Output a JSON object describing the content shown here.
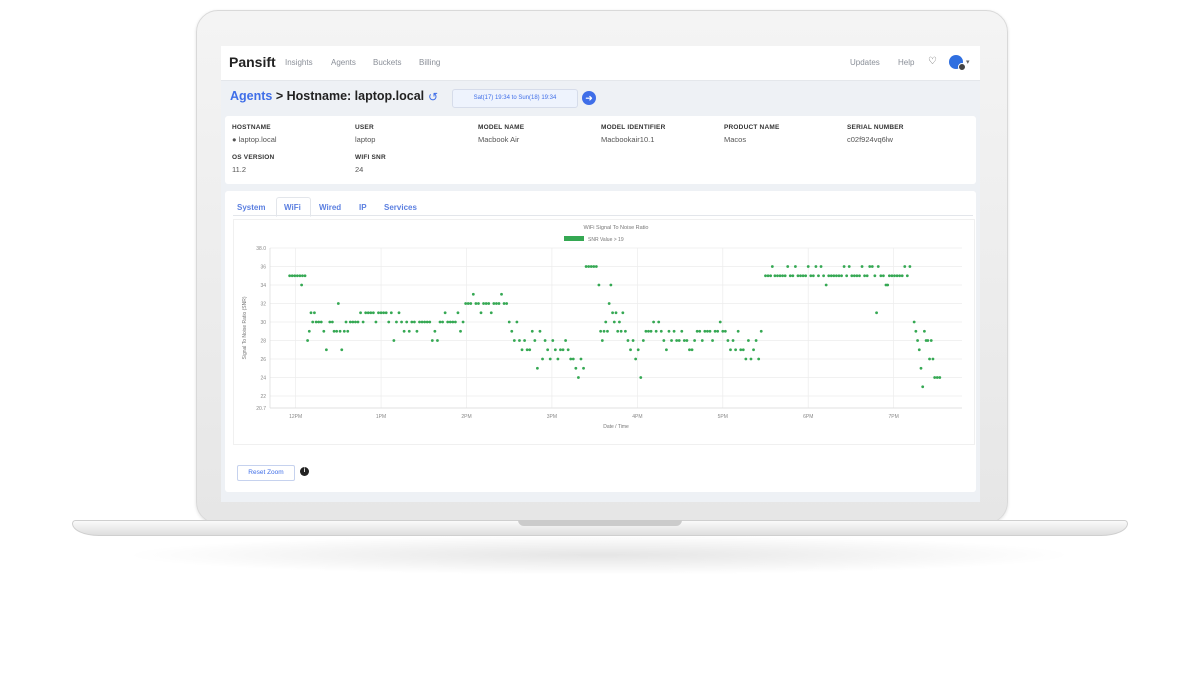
{
  "nav": {
    "brand": "Pansift",
    "links": [
      "Insights",
      "Agents",
      "Buckets",
      "Billing"
    ],
    "right_links": [
      "Updates",
      "Help"
    ],
    "icons": [
      "bell-icon",
      "avatar"
    ]
  },
  "header": {
    "breadcrumb_agents": "Agents",
    "breadcrumb_rest": " > Hostname: laptop.local",
    "date_range": "Sat(17) 19:34 to Sun(18) 19:34",
    "icons": [
      "history-icon",
      "arrow-right-circle-icon"
    ]
  },
  "agent_info": {
    "fields": [
      {
        "label": "HOSTNAME",
        "value": "laptop.local"
      },
      {
        "label": "USER",
        "value": "laptop"
      },
      {
        "label": "MODEL NAME",
        "value": "Macbook Air"
      },
      {
        "label": "MODEL IDENTIFIER",
        "value": "Macbookair10.1"
      },
      {
        "label": "PRODUCT NAME",
        "value": "Macos"
      },
      {
        "label": "SERIAL NUMBER",
        "value": "c02f924vq6lw"
      },
      {
        "label": "OS VERSION",
        "value": "11.2"
      },
      {
        "label": "WIFI SNR",
        "value": "24"
      }
    ]
  },
  "tabs": [
    "System",
    "WiFi",
    "Wired",
    "IP",
    "Services"
  ],
  "active_tab": "WiFi",
  "reset_zoom": "Reset Zoom",
  "colors": {
    "accent": "#3f6ee8",
    "series": "#35a853"
  },
  "chart_data": {
    "type": "scatter",
    "title": "WiFi Signal To Noise Ratio",
    "xlabel": "Date / Time",
    "ylabel": "Signal To Noise Ratio (SNR)",
    "ylim": [
      20.7,
      38.0
    ],
    "yticks": [
      "38.0",
      "36",
      "34",
      "32",
      "30",
      "28",
      "26",
      "24",
      "22",
      "20.7"
    ],
    "xticks": [
      "12PM",
      "1PM",
      "2PM",
      "3PM",
      "4PM",
      "5PM",
      "6PM",
      "7PM"
    ],
    "legend": "SNR Value > 19",
    "grid": true,
    "series": [
      {
        "name": "SNR Value > 19",
        "points": [
          [
            11.93,
            35
          ],
          [
            11.96,
            35
          ],
          [
            11.99,
            35
          ],
          [
            12.02,
            35
          ],
          [
            12.05,
            35
          ],
          [
            12.08,
            35
          ],
          [
            12.11,
            35
          ],
          [
            12.07,
            34
          ],
          [
            12.14,
            28
          ],
          [
            12.16,
            29
          ],
          [
            12.18,
            31
          ],
          [
            12.2,
            30
          ],
          [
            12.22,
            31
          ],
          [
            12.24,
            30
          ],
          [
            12.27,
            30
          ],
          [
            12.3,
            30
          ],
          [
            12.33,
            29
          ],
          [
            12.36,
            27
          ],
          [
            12.4,
            30
          ],
          [
            12.43,
            30
          ],
          [
            12.45,
            29
          ],
          [
            12.48,
            29
          ],
          [
            12.5,
            32
          ],
          [
            12.52,
            29
          ],
          [
            12.54,
            27
          ],
          [
            12.57,
            29
          ],
          [
            12.59,
            30
          ],
          [
            12.61,
            29
          ],
          [
            12.64,
            30
          ],
          [
            12.67,
            30
          ],
          [
            12.7,
            30
          ],
          [
            12.73,
            30
          ],
          [
            12.76,
            31
          ],
          [
            12.79,
            30
          ],
          [
            12.82,
            31
          ],
          [
            12.85,
            31
          ],
          [
            12.88,
            31
          ],
          [
            12.91,
            31
          ],
          [
            12.94,
            30
          ],
          [
            12.97,
            31
          ],
          [
            13.0,
            31
          ],
          [
            13.03,
            31
          ],
          [
            13.06,
            31
          ],
          [
            13.09,
            30
          ],
          [
            13.12,
            31
          ],
          [
            13.15,
            28
          ],
          [
            13.18,
            30
          ],
          [
            13.21,
            31
          ],
          [
            13.24,
            30
          ],
          [
            13.27,
            29
          ],
          [
            13.3,
            30
          ],
          [
            13.33,
            29
          ],
          [
            13.36,
            30
          ],
          [
            13.39,
            30
          ],
          [
            13.42,
            29
          ],
          [
            13.45,
            30
          ],
          [
            13.48,
            30
          ],
          [
            13.51,
            30
          ],
          [
            13.54,
            30
          ],
          [
            13.57,
            30
          ],
          [
            13.6,
            28
          ],
          [
            13.63,
            29
          ],
          [
            13.66,
            28
          ],
          [
            13.69,
            30
          ],
          [
            13.72,
            30
          ],
          [
            13.75,
            31
          ],
          [
            13.78,
            30
          ],
          [
            13.81,
            30
          ],
          [
            13.84,
            30
          ],
          [
            13.87,
            30
          ],
          [
            13.9,
            31
          ],
          [
            13.93,
            29
          ],
          [
            13.96,
            30
          ],
          [
            13.99,
            32
          ],
          [
            14.02,
            32
          ],
          [
            14.05,
            32
          ],
          [
            14.08,
            33
          ],
          [
            14.11,
            32
          ],
          [
            14.14,
            32
          ],
          [
            14.17,
            31
          ],
          [
            14.2,
            32
          ],
          [
            14.23,
            32
          ],
          [
            14.26,
            32
          ],
          [
            14.29,
            31
          ],
          [
            14.32,
            32
          ],
          [
            14.35,
            32
          ],
          [
            14.38,
            32
          ],
          [
            14.41,
            33
          ],
          [
            14.44,
            32
          ],
          [
            14.47,
            32
          ],
          [
            14.5,
            30
          ],
          [
            14.53,
            29
          ],
          [
            14.56,
            28
          ],
          [
            14.59,
            30
          ],
          [
            14.62,
            28
          ],
          [
            14.65,
            27
          ],
          [
            14.68,
            28
          ],
          [
            14.71,
            27
          ],
          [
            14.74,
            27
          ],
          [
            14.77,
            29
          ],
          [
            14.8,
            28
          ],
          [
            14.83,
            25
          ],
          [
            14.86,
            29
          ],
          [
            14.89,
            26
          ],
          [
            14.92,
            28
          ],
          [
            14.95,
            27
          ],
          [
            14.98,
            26
          ],
          [
            15.01,
            28
          ],
          [
            15.04,
            27
          ],
          [
            15.07,
            26
          ],
          [
            15.1,
            27
          ],
          [
            15.13,
            27
          ],
          [
            15.16,
            28
          ],
          [
            15.19,
            27
          ],
          [
            15.22,
            26
          ],
          [
            15.25,
            26
          ],
          [
            15.28,
            25
          ],
          [
            15.31,
            24
          ],
          [
            15.34,
            26
          ],
          [
            15.37,
            25
          ],
          [
            15.4,
            36
          ],
          [
            15.43,
            36
          ],
          [
            15.46,
            36
          ],
          [
            15.49,
            36
          ],
          [
            15.52,
            36
          ],
          [
            15.55,
            34
          ],
          [
            15.57,
            29
          ],
          [
            15.59,
            28
          ],
          [
            15.61,
            29
          ],
          [
            15.63,
            30
          ],
          [
            15.65,
            29
          ],
          [
            15.67,
            32
          ],
          [
            15.69,
            34
          ],
          [
            15.71,
            31
          ],
          [
            15.73,
            30
          ],
          [
            15.75,
            31
          ],
          [
            15.77,
            29
          ],
          [
            15.79,
            30
          ],
          [
            15.81,
            29
          ],
          [
            15.83,
            31
          ],
          [
            15.86,
            29
          ],
          [
            15.89,
            28
          ],
          [
            15.92,
            27
          ],
          [
            15.95,
            28
          ],
          [
            15.98,
            26
          ],
          [
            16.01,
            27
          ],
          [
            16.04,
            24
          ],
          [
            16.07,
            28
          ],
          [
            16.1,
            29
          ],
          [
            16.13,
            29
          ],
          [
            16.16,
            29
          ],
          [
            16.19,
            30
          ],
          [
            16.22,
            29
          ],
          [
            16.25,
            30
          ],
          [
            16.28,
            29
          ],
          [
            16.31,
            28
          ],
          [
            16.34,
            27
          ],
          [
            16.37,
            29
          ],
          [
            16.4,
            28
          ],
          [
            16.43,
            29
          ],
          [
            16.46,
            28
          ],
          [
            16.49,
            28
          ],
          [
            16.52,
            29
          ],
          [
            16.55,
            28
          ],
          [
            16.58,
            28
          ],
          [
            16.61,
            27
          ],
          [
            16.64,
            27
          ],
          [
            16.67,
            28
          ],
          [
            16.7,
            29
          ],
          [
            16.73,
            29
          ],
          [
            16.76,
            28
          ],
          [
            16.79,
            29
          ],
          [
            16.82,
            29
          ],
          [
            16.85,
            29
          ],
          [
            16.88,
            28
          ],
          [
            16.91,
            29
          ],
          [
            16.94,
            29
          ],
          [
            16.97,
            30
          ],
          [
            17.0,
            29
          ],
          [
            17.03,
            29
          ],
          [
            17.06,
            28
          ],
          [
            17.09,
            27
          ],
          [
            17.12,
            28
          ],
          [
            17.15,
            27
          ],
          [
            17.18,
            29
          ],
          [
            17.21,
            27
          ],
          [
            17.24,
            27
          ],
          [
            17.27,
            26
          ],
          [
            17.3,
            28
          ],
          [
            17.33,
            26
          ],
          [
            17.36,
            27
          ],
          [
            17.39,
            28
          ],
          [
            17.42,
            26
          ],
          [
            17.5,
            35
          ],
          [
            17.53,
            35
          ],
          [
            17.56,
            35
          ],
          [
            17.58,
            36
          ],
          [
            17.61,
            35
          ],
          [
            17.64,
            35
          ],
          [
            17.67,
            35
          ],
          [
            17.7,
            35
          ],
          [
            17.73,
            35
          ],
          [
            17.76,
            36
          ],
          [
            17.79,
            35
          ],
          [
            17.82,
            35
          ],
          [
            17.85,
            36
          ],
          [
            17.88,
            35
          ],
          [
            17.91,
            35
          ],
          [
            17.94,
            35
          ],
          [
            17.97,
            35
          ],
          [
            18.0,
            36
          ],
          [
            18.03,
            35
          ],
          [
            18.06,
            35
          ],
          [
            18.09,
            36
          ],
          [
            18.12,
            35
          ],
          [
            18.15,
            36
          ],
          [
            18.18,
            35
          ],
          [
            18.21,
            34
          ],
          [
            18.24,
            35
          ],
          [
            18.27,
            35
          ],
          [
            18.3,
            35
          ],
          [
            18.33,
            35
          ],
          [
            18.36,
            35
          ],
          [
            18.39,
            35
          ],
          [
            18.42,
            36
          ],
          [
            18.45,
            35
          ],
          [
            18.48,
            36
          ],
          [
            18.51,
            35
          ],
          [
            18.54,
            35
          ],
          [
            18.57,
            35
          ],
          [
            18.6,
            35
          ],
          [
            18.63,
            36
          ],
          [
            18.66,
            35
          ],
          [
            18.69,
            35
          ],
          [
            18.72,
            36
          ],
          [
            18.75,
            36
          ],
          [
            18.78,
            35
          ],
          [
            18.8,
            31
          ],
          [
            18.82,
            36
          ],
          [
            18.85,
            35
          ],
          [
            18.88,
            35
          ],
          [
            18.91,
            34
          ],
          [
            18.93,
            34
          ],
          [
            18.95,
            35
          ],
          [
            18.98,
            35
          ],
          [
            19.01,
            35
          ],
          [
            19.04,
            35
          ],
          [
            19.07,
            35
          ],
          [
            19.1,
            35
          ],
          [
            19.13,
            36
          ],
          [
            19.16,
            35
          ],
          [
            19.19,
            36
          ],
          [
            19.24,
            30
          ],
          [
            19.26,
            29
          ],
          [
            19.28,
            28
          ],
          [
            19.3,
            27
          ],
          [
            19.32,
            25
          ],
          [
            19.34,
            23
          ],
          [
            19.36,
            29
          ],
          [
            19.38,
            28
          ],
          [
            19.4,
            28
          ],
          [
            19.42,
            26
          ],
          [
            19.44,
            28
          ],
          [
            19.46,
            26
          ],
          [
            19.48,
            24
          ],
          [
            19.51,
            24
          ],
          [
            19.54,
            24
          ],
          [
            17.45,
            29
          ]
        ]
      }
    ]
  }
}
